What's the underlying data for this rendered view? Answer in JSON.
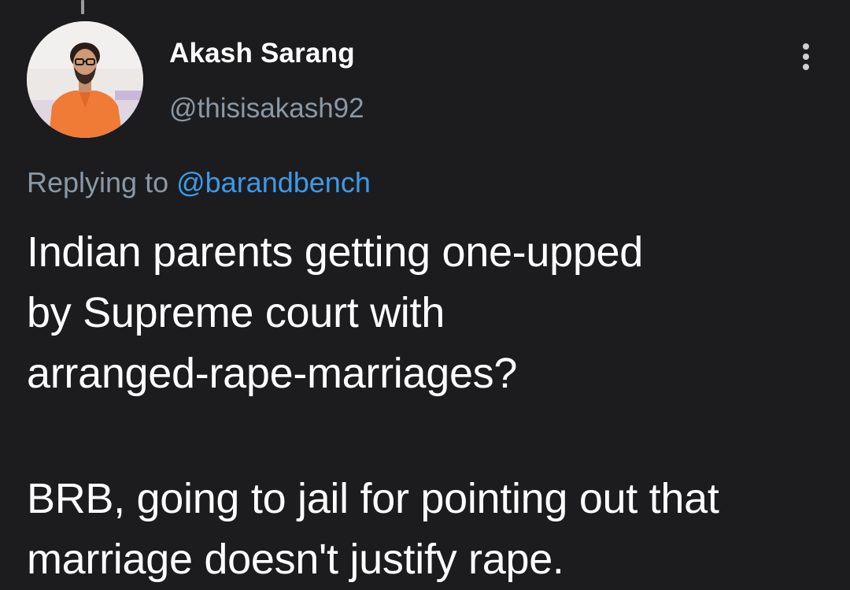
{
  "tweet": {
    "author": {
      "display_name": "Akash Sarang",
      "handle": "@thisisakash92",
      "avatar_icon": "profile-photo"
    },
    "reply_context": {
      "prefix": "Replying to ",
      "mention": "@barandbench"
    },
    "paragraphs": [
      "Indian parents getting one-upped\nby Supreme court with\narranged-rape-marriages?",
      "BRB, going to jail for pointing out that\nmarriage doesn't justify rape."
    ],
    "more_icon": "vertical-ellipsis-icon"
  },
  "colors": {
    "background": "#1c1c1e",
    "text_primary": "#ffffff",
    "text_secondary": "#8b98a5",
    "link": "#3d9ae8"
  }
}
